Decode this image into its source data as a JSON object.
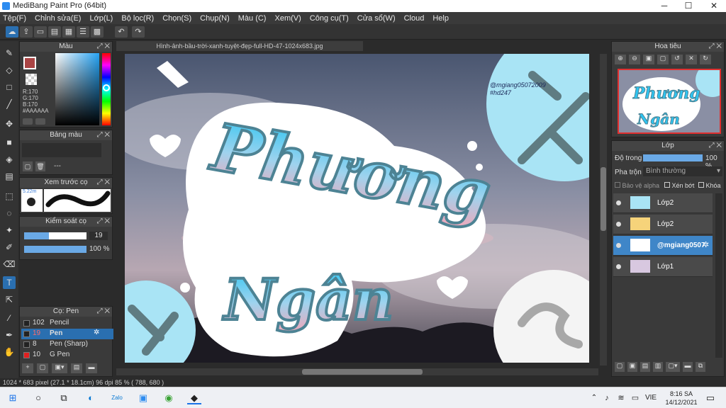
{
  "window": {
    "title": "MediBang Paint Pro (64bit)",
    "minimize": "─",
    "maximize": "☐",
    "close": "✕"
  },
  "menu": [
    "Tệp(F)",
    "Chỉnh sửa(E)",
    "Lớp(L)",
    "Bộ lọc(R)",
    "Chọn(S)",
    "Chụp(N)",
    "Màu (C)",
    "Xem(V)",
    "Công cụ(T)",
    "Cửa sổ(W)",
    "Cloud",
    "Help"
  ],
  "color_panel": {
    "title": "Màu",
    "r": "R:170",
    "g": "G:170",
    "b": "B:170",
    "hex": "#AAAAAA"
  },
  "palette_panel": {
    "title": "Bảng màu",
    "dashes": "---"
  },
  "brush_preview": {
    "title": "Xem trước cọ",
    "size": "5.22m"
  },
  "brush_control": {
    "title": "Kiểm soát cọ",
    "size_value": "19",
    "opacity_value": "100 %"
  },
  "brush_panel": {
    "title": "Cọ: Pen",
    "items": [
      {
        "size": "102",
        "name": "Pencil",
        "color": "#222222"
      },
      {
        "size": "19",
        "name": "Pen",
        "color": "#222222",
        "selected": true
      },
      {
        "size": "8",
        "name": "Pen (Sharp)",
        "color": "#222222"
      },
      {
        "size": "10",
        "name": "G Pen",
        "color": "#e02020"
      }
    ]
  },
  "document": {
    "tab": "Hình-ảnh-bầu-trời-xanh-tuyệt-đẹp-full-HD-47-1024x683.jpg"
  },
  "artwork": {
    "line1": "Phương",
    "line2": "Ngân",
    "watermark1": "@mgiang05072009",
    "watermark2": "#hd247"
  },
  "navigator": {
    "title": "Hoa tiêu",
    "line1": "Phương",
    "line2": "Ngân"
  },
  "layer_panel": {
    "title": "Lớp",
    "opacity_label": "Độ trong",
    "opacity_value": "100 %",
    "blend_label": "Pha trộn",
    "blend_value": "Bình thường",
    "protect_alpha": "Bảo vệ alpha",
    "clipping": "Xén bớt",
    "lock": "Khóa",
    "layers": [
      {
        "name": "Lớp2"
      },
      {
        "name": "Lớp2"
      },
      {
        "name": "@mgiang0507",
        "selected": true
      },
      {
        "name": "Lớp1"
      }
    ]
  },
  "status": {
    "text": "1024 * 683 pixel   (27.1 * 18.1cm)   96 dpi   85 %   ( 788, 680 )"
  },
  "taskbar": {
    "lang": "VIE",
    "time": "8:16 SA",
    "date": "14/12/2021",
    "zalo": "Zalo"
  }
}
